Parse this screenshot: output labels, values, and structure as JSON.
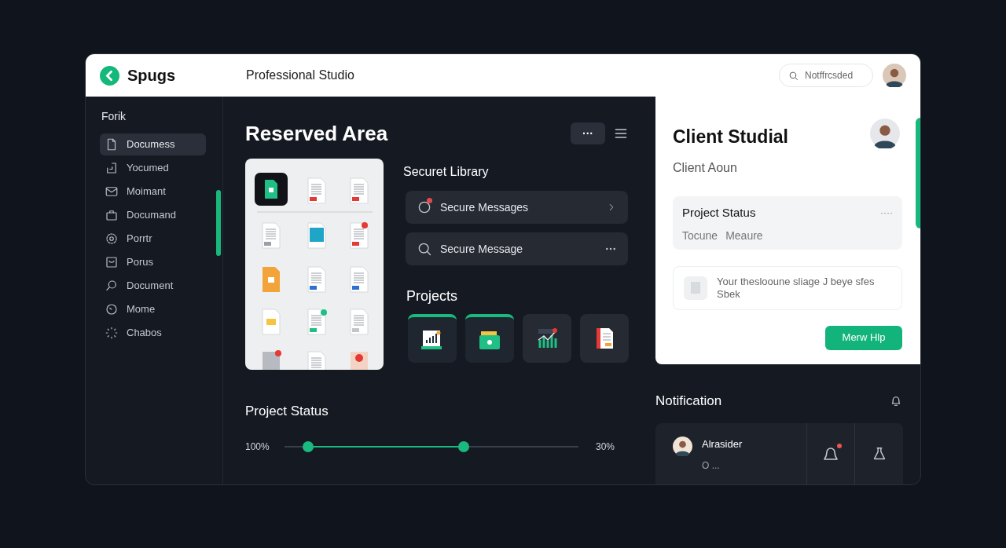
{
  "header": {
    "brand": "Spugs",
    "title": "Professional Studio",
    "search": {
      "placeholder": "Notffrcsded"
    }
  },
  "sidebar": {
    "heading": "Forik",
    "items": [
      {
        "label": "Documess",
        "kind": "file",
        "selected": true
      },
      {
        "label": "Yocumed",
        "kind": "import",
        "selected": false
      },
      {
        "label": "Moimant",
        "kind": "mail",
        "selected": false
      },
      {
        "label": "Documand",
        "kind": "bag",
        "selected": false
      },
      {
        "label": "Porrtr",
        "kind": "gear",
        "selected": false
      },
      {
        "label": "Porus",
        "kind": "inbox",
        "selected": false
      },
      {
        "label": "Document",
        "kind": "search",
        "selected": false
      },
      {
        "label": "Mome",
        "kind": "clock",
        "selected": false
      },
      {
        "label": "Chabos",
        "kind": "spinner",
        "selected": false
      }
    ]
  },
  "main": {
    "title": "Reserved Area",
    "more_button": "···",
    "library": {
      "title": "Securet Library",
      "items": [
        {
          "label": "Secure Messages",
          "kind": "chat",
          "badge": true
        },
        {
          "label": "Secure Message",
          "kind": "search",
          "badge": false
        }
      ]
    },
    "projects": {
      "title": "Projects",
      "tiles": [
        {
          "kind": "chart",
          "selected": true
        },
        {
          "kind": "folder",
          "selected": true
        },
        {
          "kind": "trend",
          "selected": false
        },
        {
          "kind": "report",
          "selected": false
        }
      ]
    },
    "status": {
      "title": "Project Status",
      "min_label": "100%",
      "max_label": "30%",
      "thumbs": [
        {
          "level": 0.08
        },
        {
          "level": 0.61
        }
      ]
    }
  },
  "client": {
    "title": "Client Studial",
    "subtitle": "Client Aoun",
    "status_card": {
      "title": "Project Status",
      "more": "····",
      "tags": [
        "Tocune",
        "Meaure"
      ]
    },
    "message": {
      "lines": [
        "Your theslooune sliage J beye sfes",
        "Sbek"
      ]
    },
    "button": "Merw Hlp"
  },
  "notifications": {
    "title": "Notification",
    "items": [
      {
        "name": "Alrasider",
        "detail": "O ...",
        "unread": true
      }
    ]
  }
}
